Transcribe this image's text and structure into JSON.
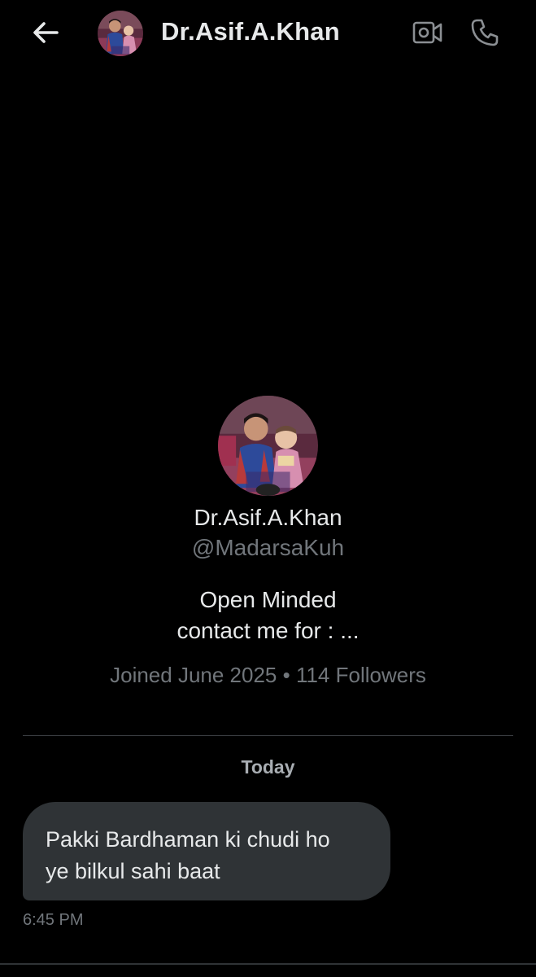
{
  "header": {
    "title": "Dr.Asif.A.Khan",
    "back_icon": "arrow-left-icon",
    "video_icon": "video-call-icon",
    "call_icon": "phone-icon"
  },
  "profile": {
    "name": "Dr.Asif.A.Khan",
    "handle": "@MadarsaKuh",
    "bio_line1": "Open Minded",
    "bio_line2": "contact me for  : ...",
    "meta": "Joined June 2025 • 114 Followers"
  },
  "conversation": {
    "day_label": "Today",
    "messages": [
      {
        "line1": "Pakki Bardhaman ki chudi ho",
        "line2": "ye bilkul sahi baat",
        "time": "6:45 PM"
      }
    ]
  },
  "colors": {
    "background": "#000000",
    "primary_text": "#e7e9ea",
    "secondary_text": "#71767b",
    "bubble": "#2f3336"
  }
}
